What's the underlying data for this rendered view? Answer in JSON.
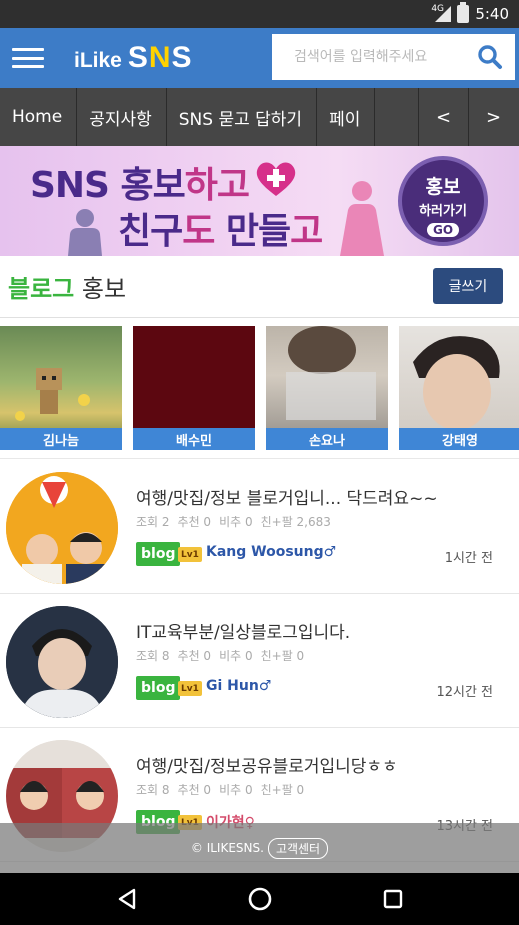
{
  "status": {
    "network": "4G",
    "time": "5:40"
  },
  "header": {
    "logo_prefix": "iLike",
    "logo_main_a": "S",
    "logo_main_b": "N",
    "logo_main_c": "S",
    "search_placeholder": "검색어를 입력해주세요"
  },
  "nav": {
    "tabs": [
      "Home",
      "공지사항",
      "SNS 묻고 답하기",
      "페이"
    ],
    "prev_label": "<",
    "next_label": ">"
  },
  "banner": {
    "line1_a": "SNS ",
    "line1_b": "홍보",
    "line1_c": "하고",
    "line2_a": "친구",
    "line2_b": "도 ",
    "line2_c": "만들",
    "line2_d": "고",
    "go_line1": "홍보",
    "go_line2": "하러가기",
    "go_badge": "GO"
  },
  "section": {
    "title_green": "블로그",
    "title_rest": " 홍보",
    "write_label": "글쓰기"
  },
  "thumbs": [
    {
      "name": "김나늠"
    },
    {
      "name": "배수민"
    },
    {
      "name": "손요나"
    },
    {
      "name": "강태영"
    }
  ],
  "posts": [
    {
      "title": "여행/맛집/정보 블로거입니... 닥드려요~~",
      "meta": [
        "조회 2",
        "추천 0",
        "비추 0",
        "친+팔 2,683"
      ],
      "tag": "blog",
      "level": "Lv1",
      "author": "Kang Woosung♂",
      "time": "1시간 전"
    },
    {
      "title": "IT교육부분/일상블로그입니다.",
      "meta": [
        "조회 8",
        "추천 0",
        "비추 0",
        "친+팔 0"
      ],
      "tag": "blog",
      "level": "Lv1",
      "author": "Gi Hun♂",
      "time": "12시간 전"
    },
    {
      "title": "여행/맛집/정보공유블로거입니당ㅎㅎ",
      "meta": [
        "조회 8",
        "추천 0",
        "비추 0",
        "친+팔 0"
      ],
      "tag": "blog",
      "level": "Lv1",
      "author": "이가현♀",
      "time": "13시간 전"
    }
  ],
  "footer": {
    "copyright": "© ILIKESNS.",
    "cs_label": "고객센터"
  },
  "colors": {
    "appbar": "#3d7cc7",
    "nav": "#464646",
    "green": "#3ab43f",
    "navy": "#2c4b7e",
    "caption": "#3f86d6"
  }
}
